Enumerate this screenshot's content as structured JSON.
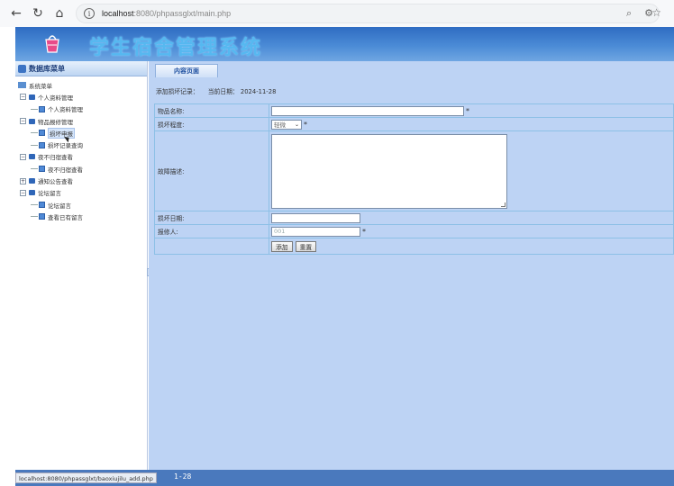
{
  "browser": {
    "url_host": "localhost",
    "url_path": ":8080/phpassglxt/main.php"
  },
  "header": {
    "title": "学生宿舍管理系统"
  },
  "sidebar": {
    "title": "数据库菜单",
    "root": "系统菜单",
    "items": [
      {
        "label": "个人资料管理",
        "level": 1
      },
      {
        "label": "个人资料管理",
        "level": 2
      },
      {
        "label": "物品报修管理",
        "level": 1
      },
      {
        "label": "损坏申报",
        "level": 2,
        "selected": true
      },
      {
        "label": "损坏记录查询",
        "level": 2
      },
      {
        "label": "夜不归宿查看",
        "level": 1
      },
      {
        "label": "夜不归宿查看",
        "level": 2
      },
      {
        "label": "通知公告查看",
        "level": 1
      },
      {
        "label": "论坛留言",
        "level": 1
      },
      {
        "label": "论坛留言",
        "level": 2
      },
      {
        "label": "查看已有留言",
        "level": 2
      }
    ]
  },
  "main": {
    "tab": "内容页面",
    "crumb": "添加损坏记录：",
    "date_label": "当前日期：",
    "date": "2024-11-28",
    "form": {
      "item_name_label": "物品名称:",
      "damage_level_label": "损坏程度:",
      "damage_level_value": "轻微",
      "description_label": "故障描述:",
      "damage_date_label": "损坏日期:",
      "reporter_label": "报修人:",
      "reporter_value": "001",
      "required_mark": "*",
      "add_button": "添加",
      "reset_button": "重置"
    }
  },
  "status": {
    "url": "localhost:8080/phpassglxt/baoxiujilu_add.php",
    "date_fragment": "1-28"
  }
}
